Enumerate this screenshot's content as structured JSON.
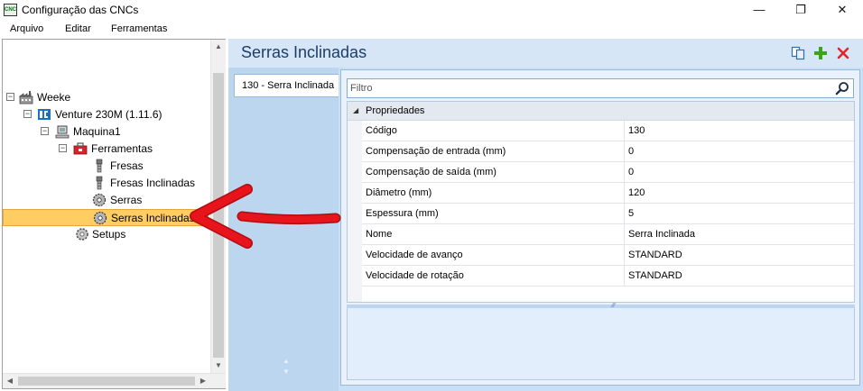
{
  "window": {
    "title": "Configuração das CNCs",
    "app_icon_text": "CNC",
    "controls": {
      "minimize": "—",
      "maximize": "❐",
      "close": "✕"
    }
  },
  "menu": [
    "Arquivo",
    "Editar",
    "Ferramentas"
  ],
  "tree": {
    "nodes": [
      {
        "label": "Weeke",
        "icon": "factory-icon",
        "expander": "−"
      },
      {
        "label": "Venture 230M (1.11.6)",
        "icon": "machine-icon",
        "expander": "−"
      },
      {
        "label": "Maquina1",
        "icon": "computer-icon",
        "expander": "−"
      },
      {
        "label": "Ferramentas",
        "icon": "toolbox-icon",
        "expander": "−"
      },
      {
        "label": "Fresas",
        "icon": "drill-bit-icon"
      },
      {
        "label": "Fresas Inclinadas",
        "icon": "drill-bit-icon"
      },
      {
        "label": "Serras",
        "icon": "saw-blade-icon"
      },
      {
        "label": "Serras Inclinadas",
        "icon": "saw-blade-icon",
        "selected": true
      },
      {
        "label": "Setups",
        "icon": "gear-icon"
      }
    ]
  },
  "main": {
    "title": "Serras Inclinadas",
    "tabs": [
      {
        "label": "130 - Serra Inclinada"
      }
    ],
    "filter": {
      "placeholder": "Filtro",
      "value": ""
    },
    "properties": {
      "category": "Propriedades",
      "rows": [
        {
          "name": "Código",
          "value": "130"
        },
        {
          "name": "Compensação de entrada (mm)",
          "value": "0"
        },
        {
          "name": "Compensação de saída (mm)",
          "value": "0"
        },
        {
          "name": "Diâmetro (mm)",
          "value": "120"
        },
        {
          "name": "Espessura (mm)",
          "value": "5"
        },
        {
          "name": "Nome",
          "value": "Serra Inclinada"
        },
        {
          "name": "Velocidade de avanço",
          "value": "STANDARD"
        },
        {
          "name": "Velocidade de rotação",
          "value": "STANDARD"
        }
      ]
    }
  },
  "colors": {
    "accent": "#1c3d66",
    "selection": "#ffcd62",
    "annotation_arrow": "#e8141b",
    "add_icon": "#3aa614",
    "delete_icon": "#e0262b"
  }
}
